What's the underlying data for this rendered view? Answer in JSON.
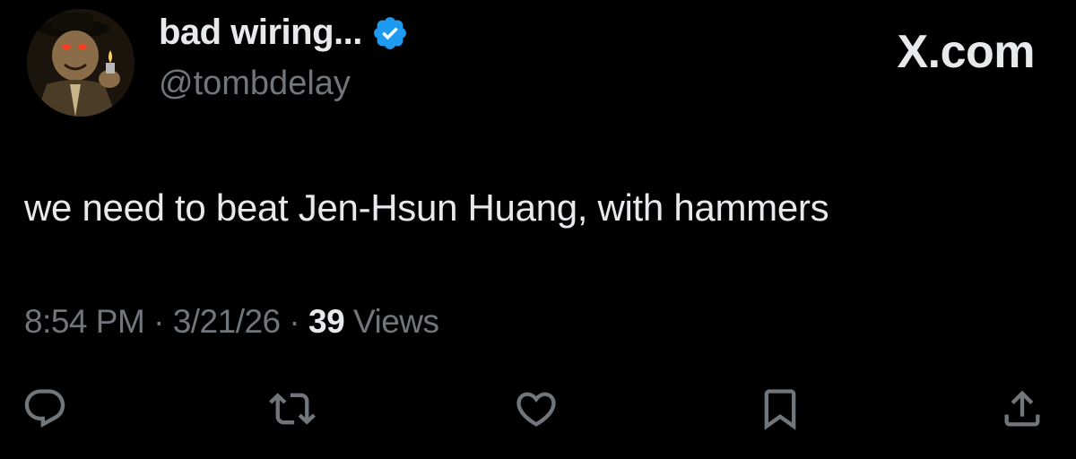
{
  "tweet": {
    "display_name": "bad wiring...",
    "handle": "@tombdelay",
    "text": "we need to beat Jen-Hsun Huang, with hammers",
    "time": "8:54 PM",
    "separator": "·",
    "date": "3/21/26",
    "views_count": "39",
    "views_label": "Views"
  },
  "brand": {
    "label": "X.com"
  },
  "actions": [
    {
      "icon": "reply-icon"
    },
    {
      "icon": "retweet-icon"
    },
    {
      "icon": "like-icon"
    },
    {
      "icon": "bookmark-icon"
    },
    {
      "icon": "share-icon"
    }
  ],
  "colors": {
    "background": "#000000",
    "primary_text": "#e7e9ea",
    "secondary_text": "#71767b",
    "verified_badge": "#1d9bf0"
  }
}
